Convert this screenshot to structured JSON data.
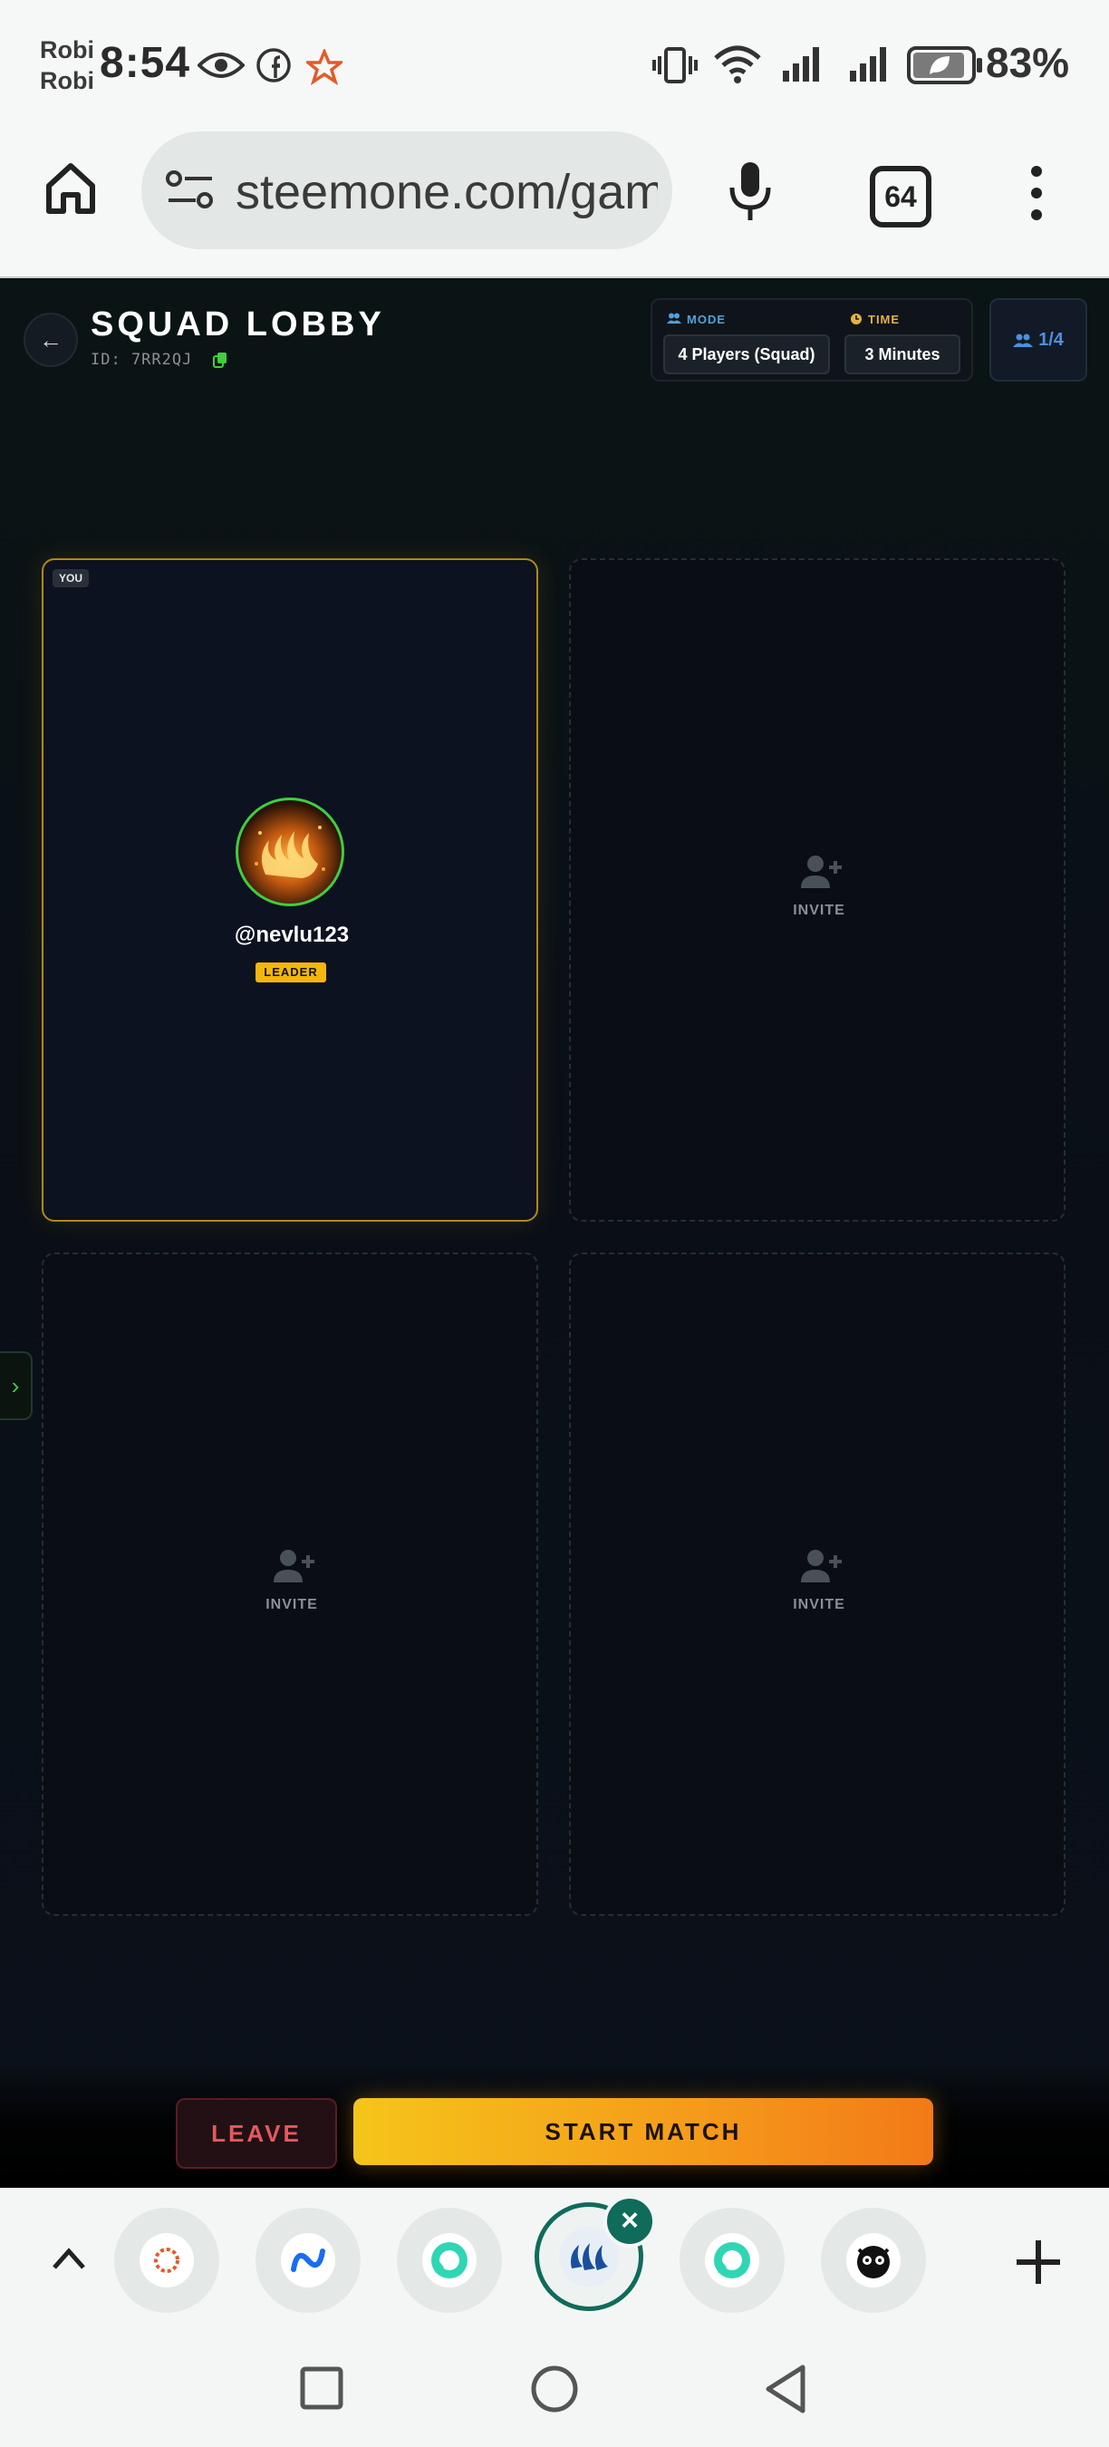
{
  "status_bar": {
    "carrier_1": "Robi",
    "carrier_2": "Robi",
    "time": "8:54",
    "battery": "83%",
    "icons": [
      "eye-icon",
      "facebook-icon",
      "star-icon",
      "vibrate-icon",
      "wifi-icon",
      "signal-icon",
      "signal-icon",
      "battery-saver-icon"
    ]
  },
  "browser": {
    "url": "steemone.com/gam",
    "tab_count": "64",
    "icons": [
      "home-icon",
      "site-settings-icon",
      "mic-icon",
      "tabs-icon",
      "more-icon"
    ]
  },
  "lobby": {
    "title": "SQUAD LOBBY",
    "id_text": "ID: 7RR2QJ",
    "mode_label": "MODE",
    "mode_value": "4 Players (Squad)",
    "time_label": "TIME",
    "time_value": "3 Minutes",
    "player_count": "1/4",
    "accent": "#f4b60d",
    "mode_color": "#4fa3d9",
    "time_color": "#e3b341",
    "slots": [
      {
        "you_badge": "YOU",
        "username": "@nevlu123",
        "role": "LEADER",
        "filled": true
      },
      {
        "label": "INVITE",
        "filled": false
      },
      {
        "label": "INVITE",
        "filled": false
      },
      {
        "label": "INVITE",
        "filled": false
      }
    ],
    "leave_label": "LEAVE",
    "start_label": "START MATCH"
  },
  "dock": {
    "bubbles": [
      "app-bubble-1",
      "app-bubble-2",
      "app-bubble-3",
      "steem-bubble",
      "app-bubble-5",
      "owl-bubble"
    ]
  }
}
